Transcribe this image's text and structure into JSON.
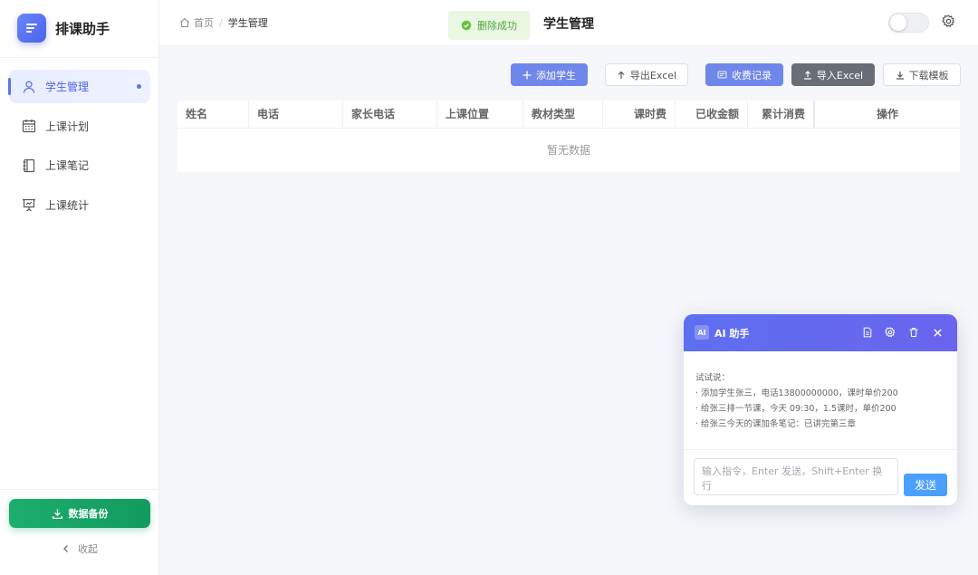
{
  "app": {
    "title": "排课助手"
  },
  "sidebar": {
    "items": [
      {
        "label": "学生管理",
        "icon": "user-icon",
        "active": true
      },
      {
        "label": "上课计划",
        "icon": "calendar-icon",
        "active": false
      },
      {
        "label": "上课笔记",
        "icon": "notebook-icon",
        "active": false
      },
      {
        "label": "上课统计",
        "icon": "presentation-chart-icon",
        "active": false
      }
    ],
    "backup_label": "数据备份",
    "collapse_label": "收起"
  },
  "header": {
    "breadcrumb": {
      "home": "首页",
      "current": "学生管理"
    },
    "toast": "删除成功",
    "page_title": "学生管理"
  },
  "toolbar": {
    "add_student": "添加学生",
    "export_excel": "导出Excel",
    "fee_records": "收费记录",
    "import_excel": "导入Excel",
    "download_template": "下载模板"
  },
  "table": {
    "columns": [
      "姓名",
      "电话",
      "家长电话",
      "上课位置",
      "教材类型",
      "课时费",
      "已收金额",
      "累计消费",
      "操作"
    ],
    "empty_text": "暂无数据"
  },
  "ai_panel": {
    "badge": "AI",
    "title": "AI 助手",
    "intro": "试试说：",
    "examples": [
      "· 添加学生张三，电话13800000000，课时单价200",
      "· 给张三排一节课，今天 09:30，1.5课时，单价200",
      "· 给张三今天的课加条笔记：已讲完第三章"
    ],
    "input_placeholder": "输入指令，Enter 发送，Shift+Enter 换行",
    "send_label": "发送"
  },
  "colors": {
    "accent": "#5a73f0",
    "primary_button": "#6f87ea",
    "success_green": "#1cae6c",
    "send_blue": "#4ba0ff",
    "dark_button": "#686d76"
  }
}
